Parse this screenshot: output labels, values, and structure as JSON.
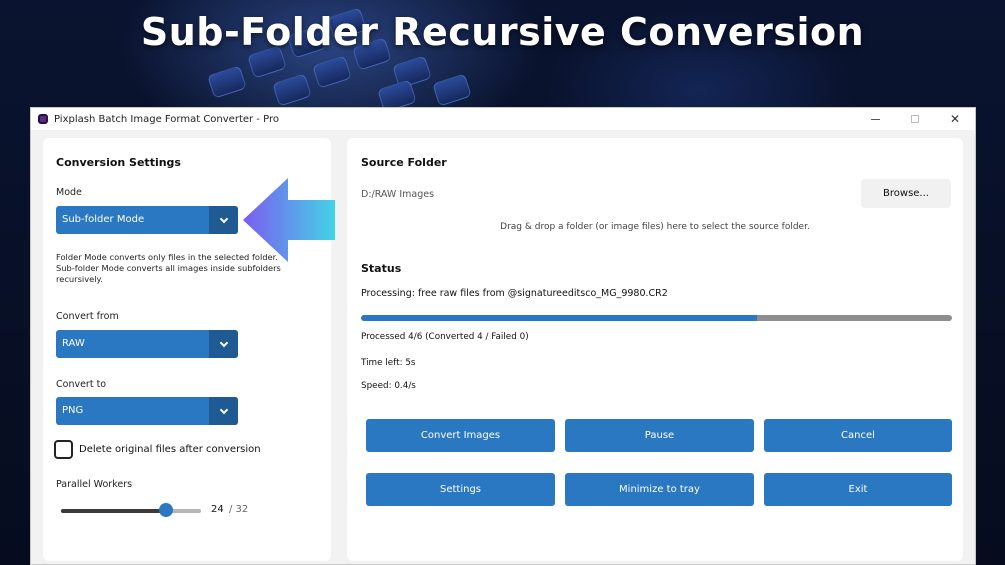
{
  "headline": "Sub-Folder Recursive Conversion",
  "window": {
    "title": "Pixplash Batch Image Format Converter - Pro"
  },
  "settings": {
    "title": "Conversion Settings",
    "mode_label": "Mode",
    "mode_value": "Sub-folder Mode",
    "mode_description": "Folder Mode converts only files in the selected folder. Sub-folder Mode converts all images inside subfolders recursively.",
    "convert_from_label": "Convert from",
    "convert_from_value": "RAW",
    "convert_to_label": "Convert to",
    "convert_to_value": "PNG",
    "delete_originals_label": "Delete original files after conversion",
    "delete_originals_checked": false,
    "parallel_workers_label": "Parallel Workers",
    "parallel_workers_value": "24",
    "parallel_workers_max": "/ 32"
  },
  "source": {
    "title": "Source Folder",
    "path": "D:/RAW Images",
    "browse_label": "Browse...",
    "drop_hint": "Drag & drop a folder (or image files) here to select the source folder."
  },
  "status": {
    "title": "Status",
    "processing": "Processing: free raw files from @signatureeditsco_MG_9980.CR2",
    "progress_fraction": 0.67,
    "processed": "Processed 4/6 (Converted 4 / Failed 0)",
    "time_left": "Time left: 5s",
    "speed": "Speed: 0.4/s"
  },
  "buttons": {
    "convert": "Convert Images",
    "pause": "Pause",
    "cancel": "Cancel",
    "settings": "Settings",
    "minimize": "Minimize to tray",
    "exit": "Exit"
  },
  "colors": {
    "accent": "#2b78c2",
    "accent_dark": "#1f5a93",
    "arrow_start": "#7b5cf0",
    "arrow_end": "#43d3e6"
  }
}
